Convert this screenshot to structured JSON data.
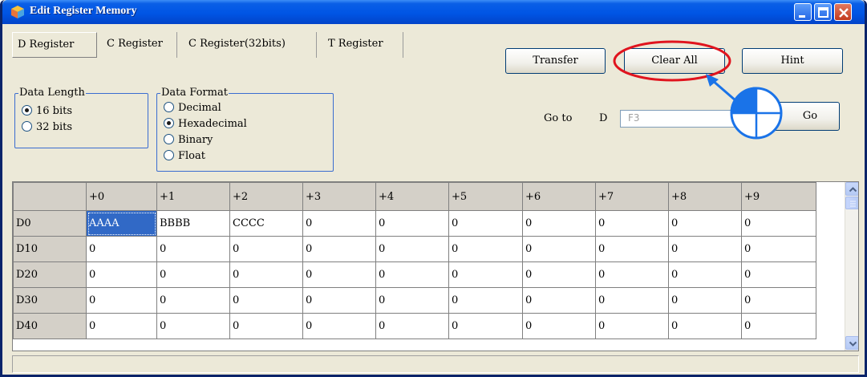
{
  "window": {
    "title": "Edit Register Memory"
  },
  "tabs": [
    {
      "label": "D Register",
      "active": true
    },
    {
      "label": "C Register",
      "active": false
    },
    {
      "label": "C Register(32bits)",
      "active": false
    },
    {
      "label": "T Register",
      "active": false
    }
  ],
  "buttons": {
    "transfer": "Transfer",
    "clear_all": "Clear All",
    "hint": "Hint",
    "go": "Go"
  },
  "data_length": {
    "legend": "Data Length",
    "options": [
      {
        "label": "16 bits",
        "selected": true
      },
      {
        "label": "32 bits",
        "selected": false
      }
    ]
  },
  "data_format": {
    "legend": "Data Format",
    "options": [
      {
        "label": "Decimal",
        "selected": false
      },
      {
        "label": "Hexadecimal",
        "selected": true
      },
      {
        "label": "Binary",
        "selected": false
      },
      {
        "label": "Float",
        "selected": false
      }
    ]
  },
  "goto": {
    "label": "Go to",
    "prefix": "D",
    "value": "F3"
  },
  "grid": {
    "columns": [
      "+0",
      "+1",
      "+2",
      "+3",
      "+4",
      "+5",
      "+6",
      "+7",
      "+8",
      "+9"
    ],
    "rows": [
      {
        "label": "D0",
        "values": [
          "AAAA",
          "BBBB",
          "CCCC",
          "0",
          "0",
          "0",
          "0",
          "0",
          "0",
          "0"
        ]
      },
      {
        "label": "D10",
        "values": [
          "0",
          "0",
          "0",
          "0",
          "0",
          "0",
          "0",
          "0",
          "0",
          "0"
        ]
      },
      {
        "label": "D20",
        "values": [
          "0",
          "0",
          "0",
          "0",
          "0",
          "0",
          "0",
          "0",
          "0",
          "0"
        ]
      },
      {
        "label": "D30",
        "values": [
          "0",
          "0",
          "0",
          "0",
          "0",
          "0",
          "0",
          "0",
          "0",
          "0"
        ]
      },
      {
        "label": "D40",
        "values": [
          "0",
          "0",
          "0",
          "0",
          "0",
          "0",
          "0",
          "0",
          "0",
          "0"
        ]
      }
    ]
  },
  "colors": {
    "title_bar": "#0055e5",
    "highlight_ring": "#e0141e",
    "callout_blue": "#1a73e8",
    "selection": "#3169c6"
  }
}
